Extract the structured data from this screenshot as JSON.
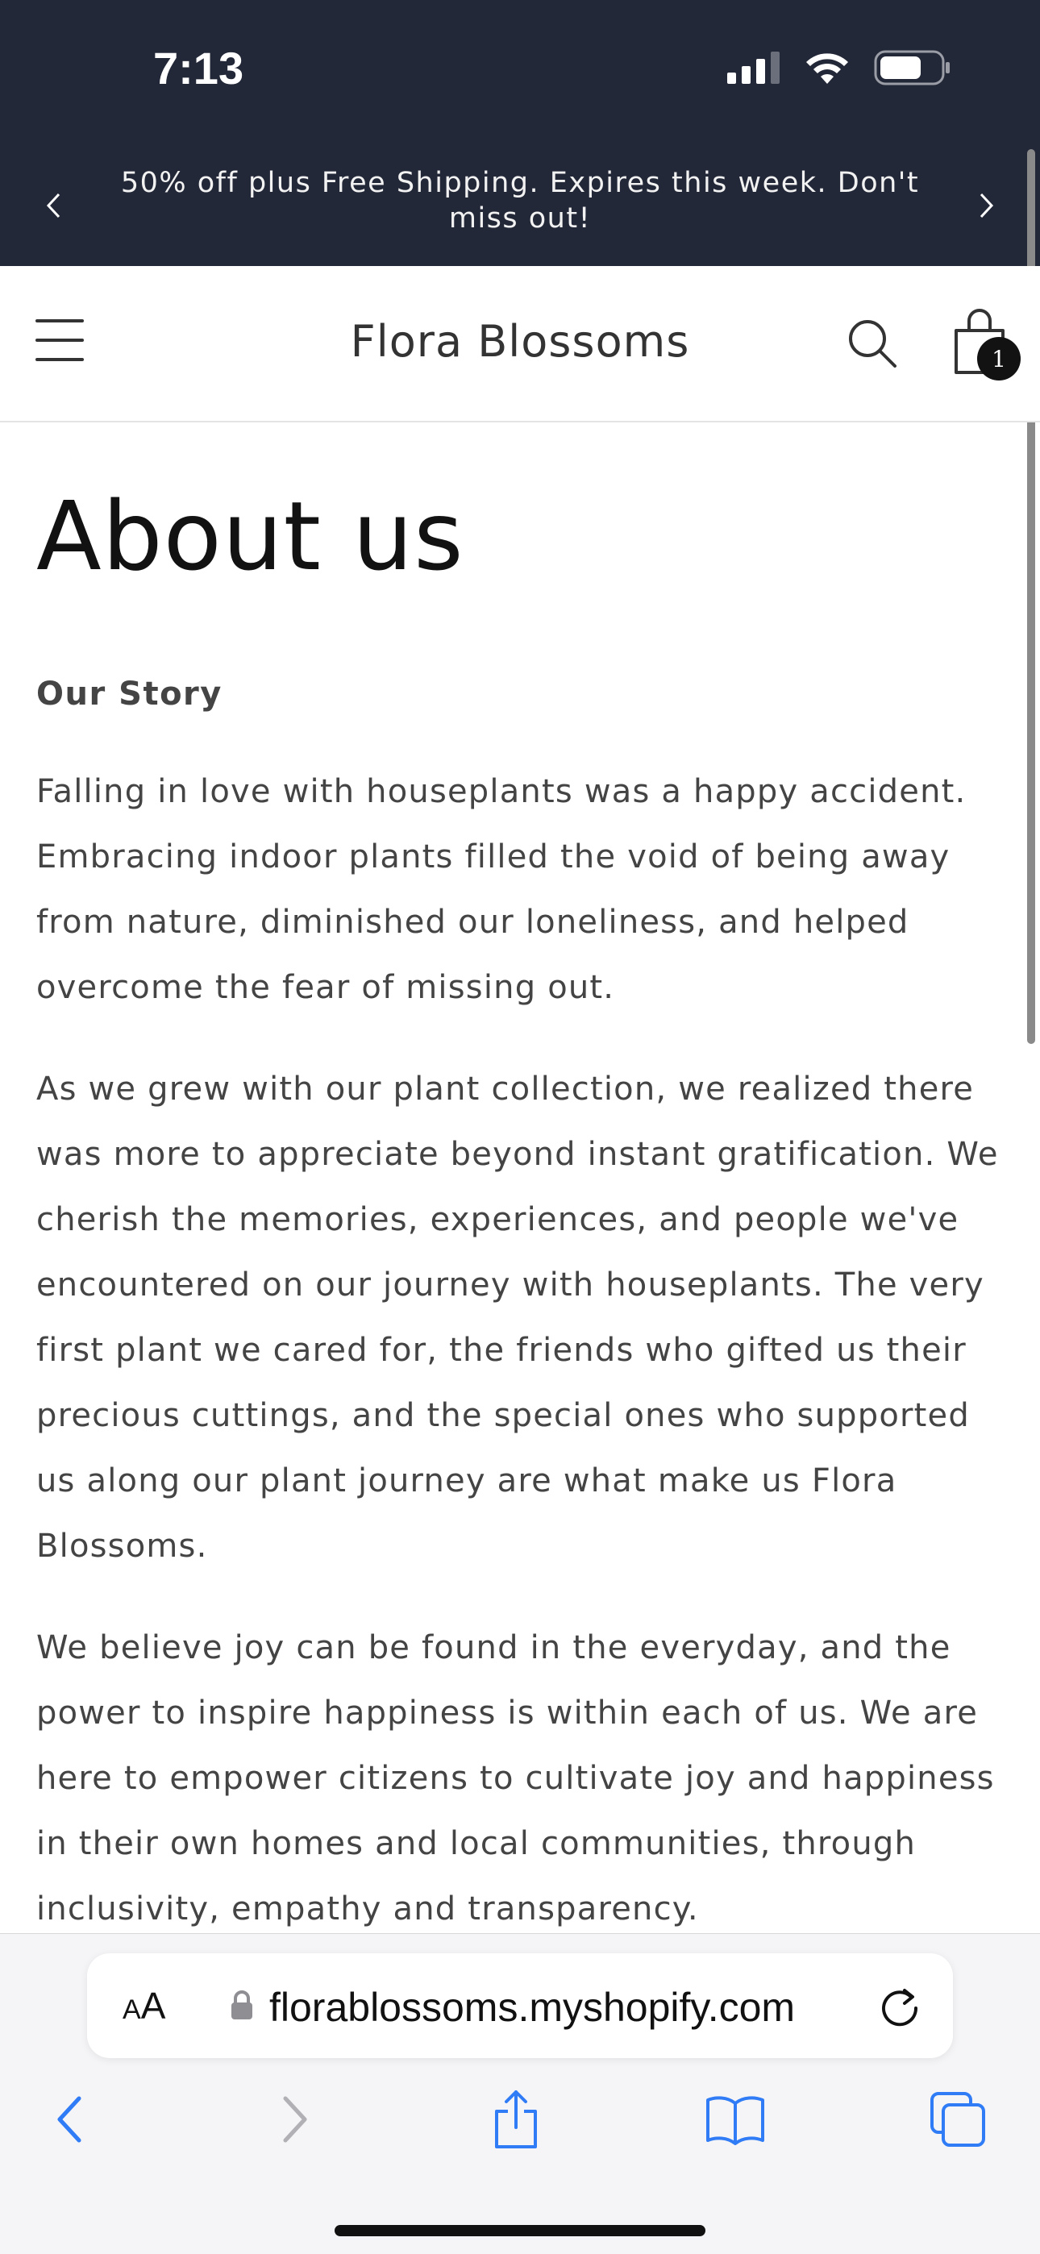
{
  "status_bar": {
    "time": "7:13"
  },
  "announcement": {
    "text": "50% off plus Free Shipping. Expires this week. Don't miss out!"
  },
  "header": {
    "brand": "Flora Blossoms",
    "cart_count": "1"
  },
  "page": {
    "title": "About us",
    "section_heading": "Our Story",
    "paragraphs": [
      "Falling in love with houseplants was a happy accident. Embracing indoor plants filled the void of being away from nature, diminished our loneliness, and helped overcome the fear of missing out.",
      "As we grew with our plant collection, we realized there was more to appreciate beyond instant gratification. We cherish the memories, experiences, and people we've encountered on our journey with houseplants. The very first plant we cared for, the friends who gifted us their precious cuttings, and the special ones who supported us along our plant journey are what make us Flora Blossoms.",
      "We believe joy can be found in the everyday, and the power to inspire happiness is within each of us. We are here to empower citizens to cultivate joy and happiness in their own homes and local communities, through inclusivity, empathy and transparency."
    ]
  },
  "browser": {
    "text_size_label_small": "A",
    "text_size_label_large": "A",
    "url": "florablossoms.myshopify.com",
    "icons": [
      "back-icon",
      "forward-icon",
      "share-icon",
      "bookmarks-icon",
      "tabs-icon",
      "reload-icon",
      "lock-icon"
    ]
  },
  "colors": {
    "top_bar": "#232838",
    "link_blue": "#2f7cf6",
    "badge": "#121212"
  }
}
